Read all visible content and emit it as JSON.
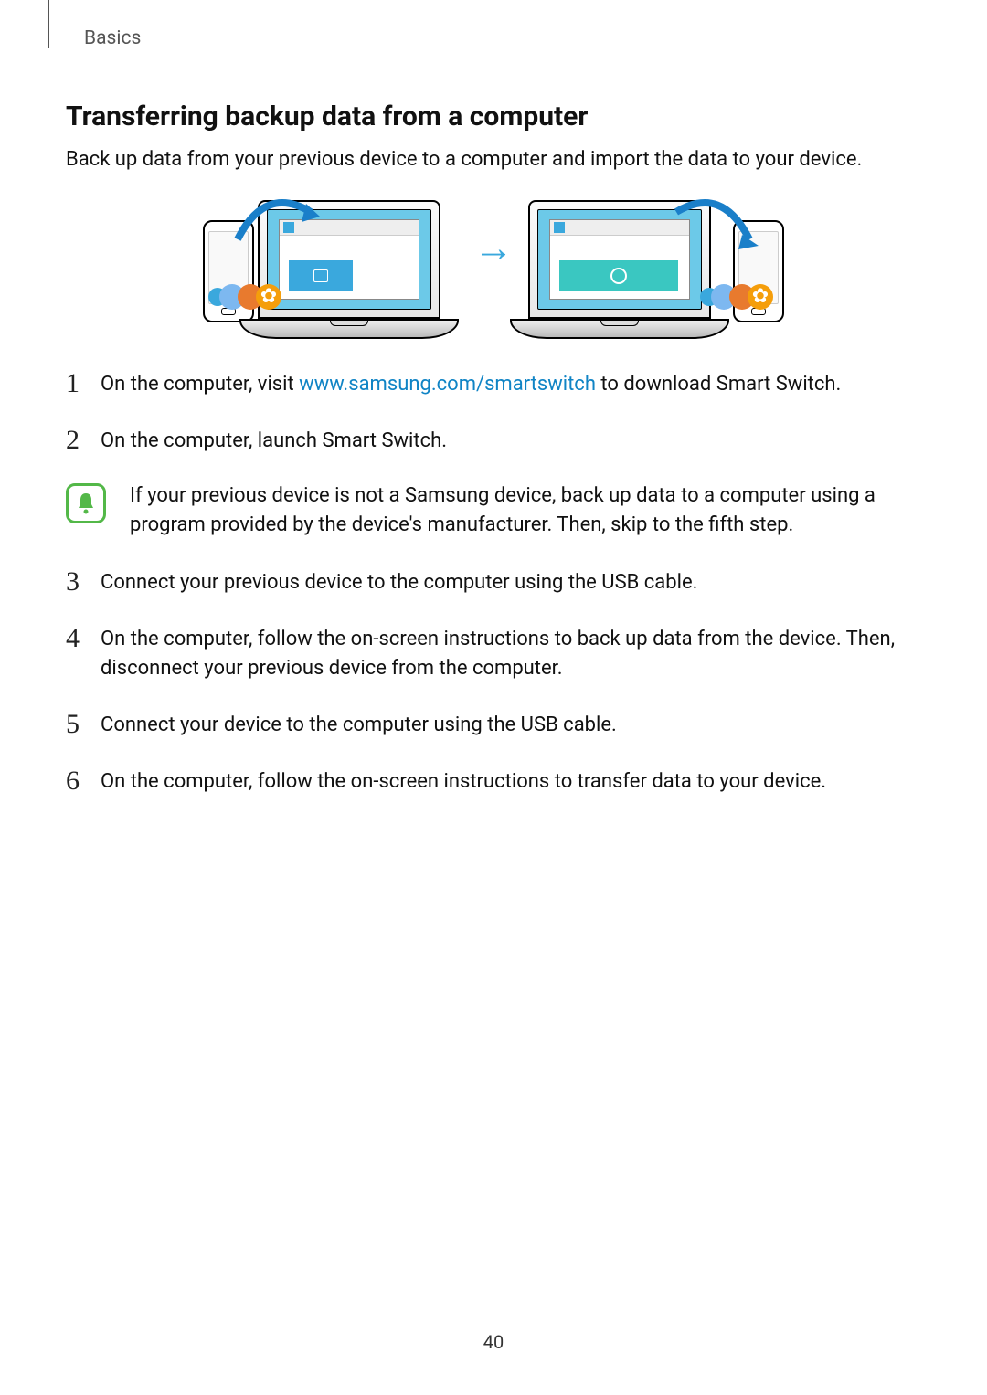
{
  "header": {
    "breadcrumb": "Basics"
  },
  "section": {
    "title": "Transferring backup data from a computer",
    "intro": "Back up data from your previous device to a computer and import the data to your device."
  },
  "steps": {
    "one": {
      "num": "1",
      "pre": "On the computer, visit ",
      "link": "www.samsung.com/smartswitch",
      "post": " to download Smart Switch."
    },
    "two": {
      "num": "2",
      "text": "On the computer, launch Smart Switch."
    },
    "note": "If your previous device is not a Samsung device, back up data to a computer using a program provided by the device's manufacturer. Then, skip to the fifth step.",
    "three": {
      "num": "3",
      "text": "Connect your previous device to the computer using the USB cable."
    },
    "four": {
      "num": "4",
      "text": "On the computer, follow the on-screen instructions to back up data from the device. Then, disconnect your previous device from the computer."
    },
    "five": {
      "num": "5",
      "text": "Connect your device to the computer using the USB cable."
    },
    "six": {
      "num": "6",
      "text": "On the computer, follow the on-screen instructions to transfer data to your device."
    }
  },
  "page_number": "40"
}
